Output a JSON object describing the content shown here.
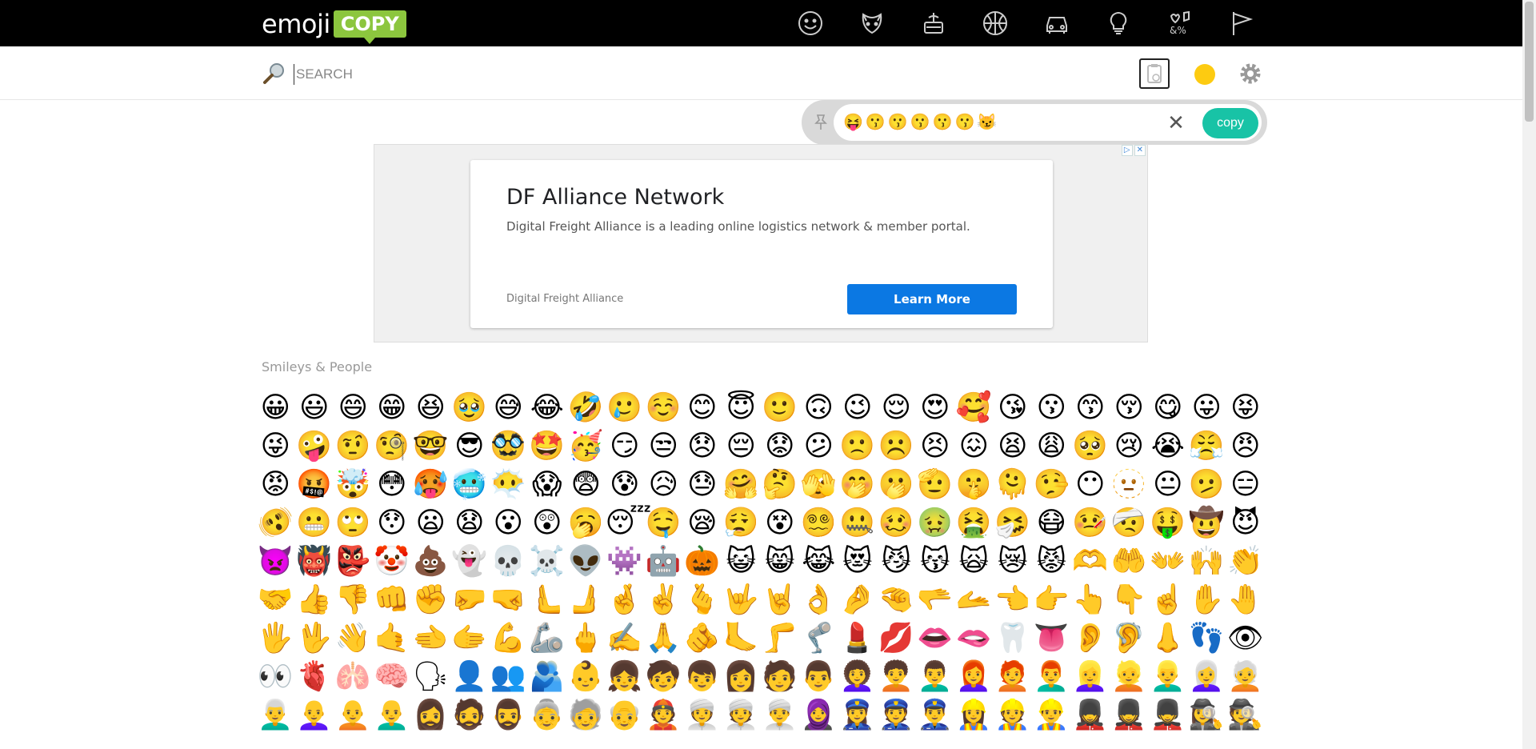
{
  "header": {
    "logo_word": "emoji",
    "logo_badge": "COPY",
    "categories": [
      "smileys-icon",
      "animals-icon",
      "food-icon",
      "activities-icon",
      "travel-icon",
      "objects-icon",
      "symbols-icon",
      "flags-icon"
    ]
  },
  "search": {
    "placeholder": "SEARCH"
  },
  "tray": {
    "emojis": "😝😗😗😗😗😗😼",
    "copy_label": "copy",
    "close_glyph": "✕"
  },
  "ad": {
    "title": "DF Alliance Network",
    "description": "Digital Freight Alliance is a leading online logistics network & member portal.",
    "advertiser": "Digital Freight Alliance",
    "cta": "Learn More"
  },
  "section": {
    "title": "Smileys & People"
  },
  "emoji_rows": [
    "😀😃😄😁😆🥹😅😂🤣🥲☺️😊😇🙂🙃😉😌😍🥰😘😗😙😚😋😛😝",
    "😜🤪🤨🧐🤓😎🥸🤩🥳😏😒😞😔😟😕🙁☹️😣😖😫😩🥺😢😭😤😠",
    "😡🤬🤯😳🥵🥶😶‍🌫️😱😨😰😥😓🤗🤔🫣🤭🫢🫡🤫🫠🤥😶🫥😐🫤😑",
    "🫨😬🙄😯😦😧😮😲🥱😴🤤😪😮‍💨😵😵‍💫🤐🥴🤢🤮🤧😷🤒🤕🤑🤠😈",
    "👿👹👺🤡💩👻💀☠️👽👾🤖🎃😺😸😹😻😼😽🙀😿😾🫶🤲👐🙌👏",
    "🤝👍👎👊✊🤛🤜🫷🫸🤞✌️🫰🤟🤘👌🤌🤏🫳🫴👈👉👆👇☝️✋🤚",
    "🖐🖖👋🤙🫲🫱💪🦾🖕✍️🙏🫵🦶🦵🦿💄💋👄🫦🦷👅👂🦻👃👣👁",
    "👀🫀🫁🧠🗣👤👥🫂👶👧🧒👦👩🧑👨👩‍🦱🧑‍🦱👨‍🦱👩‍🦰🧑‍🦰👨‍🦰👱‍♀️👱👱‍♂️👩‍🦳🧑‍🦳",
    "👨‍🦳👩‍🦲🧑‍🦲👨‍🦲🧔‍♀️🧔🧔‍♂️👵🧓👴👲👳‍♀️👳👳‍♂️🧕👮‍♀️👮👮‍♂️👷‍♀️👷👷‍♂️💂‍♀️💂💂‍♂️🕵️‍♀️🕵️"
  ]
}
